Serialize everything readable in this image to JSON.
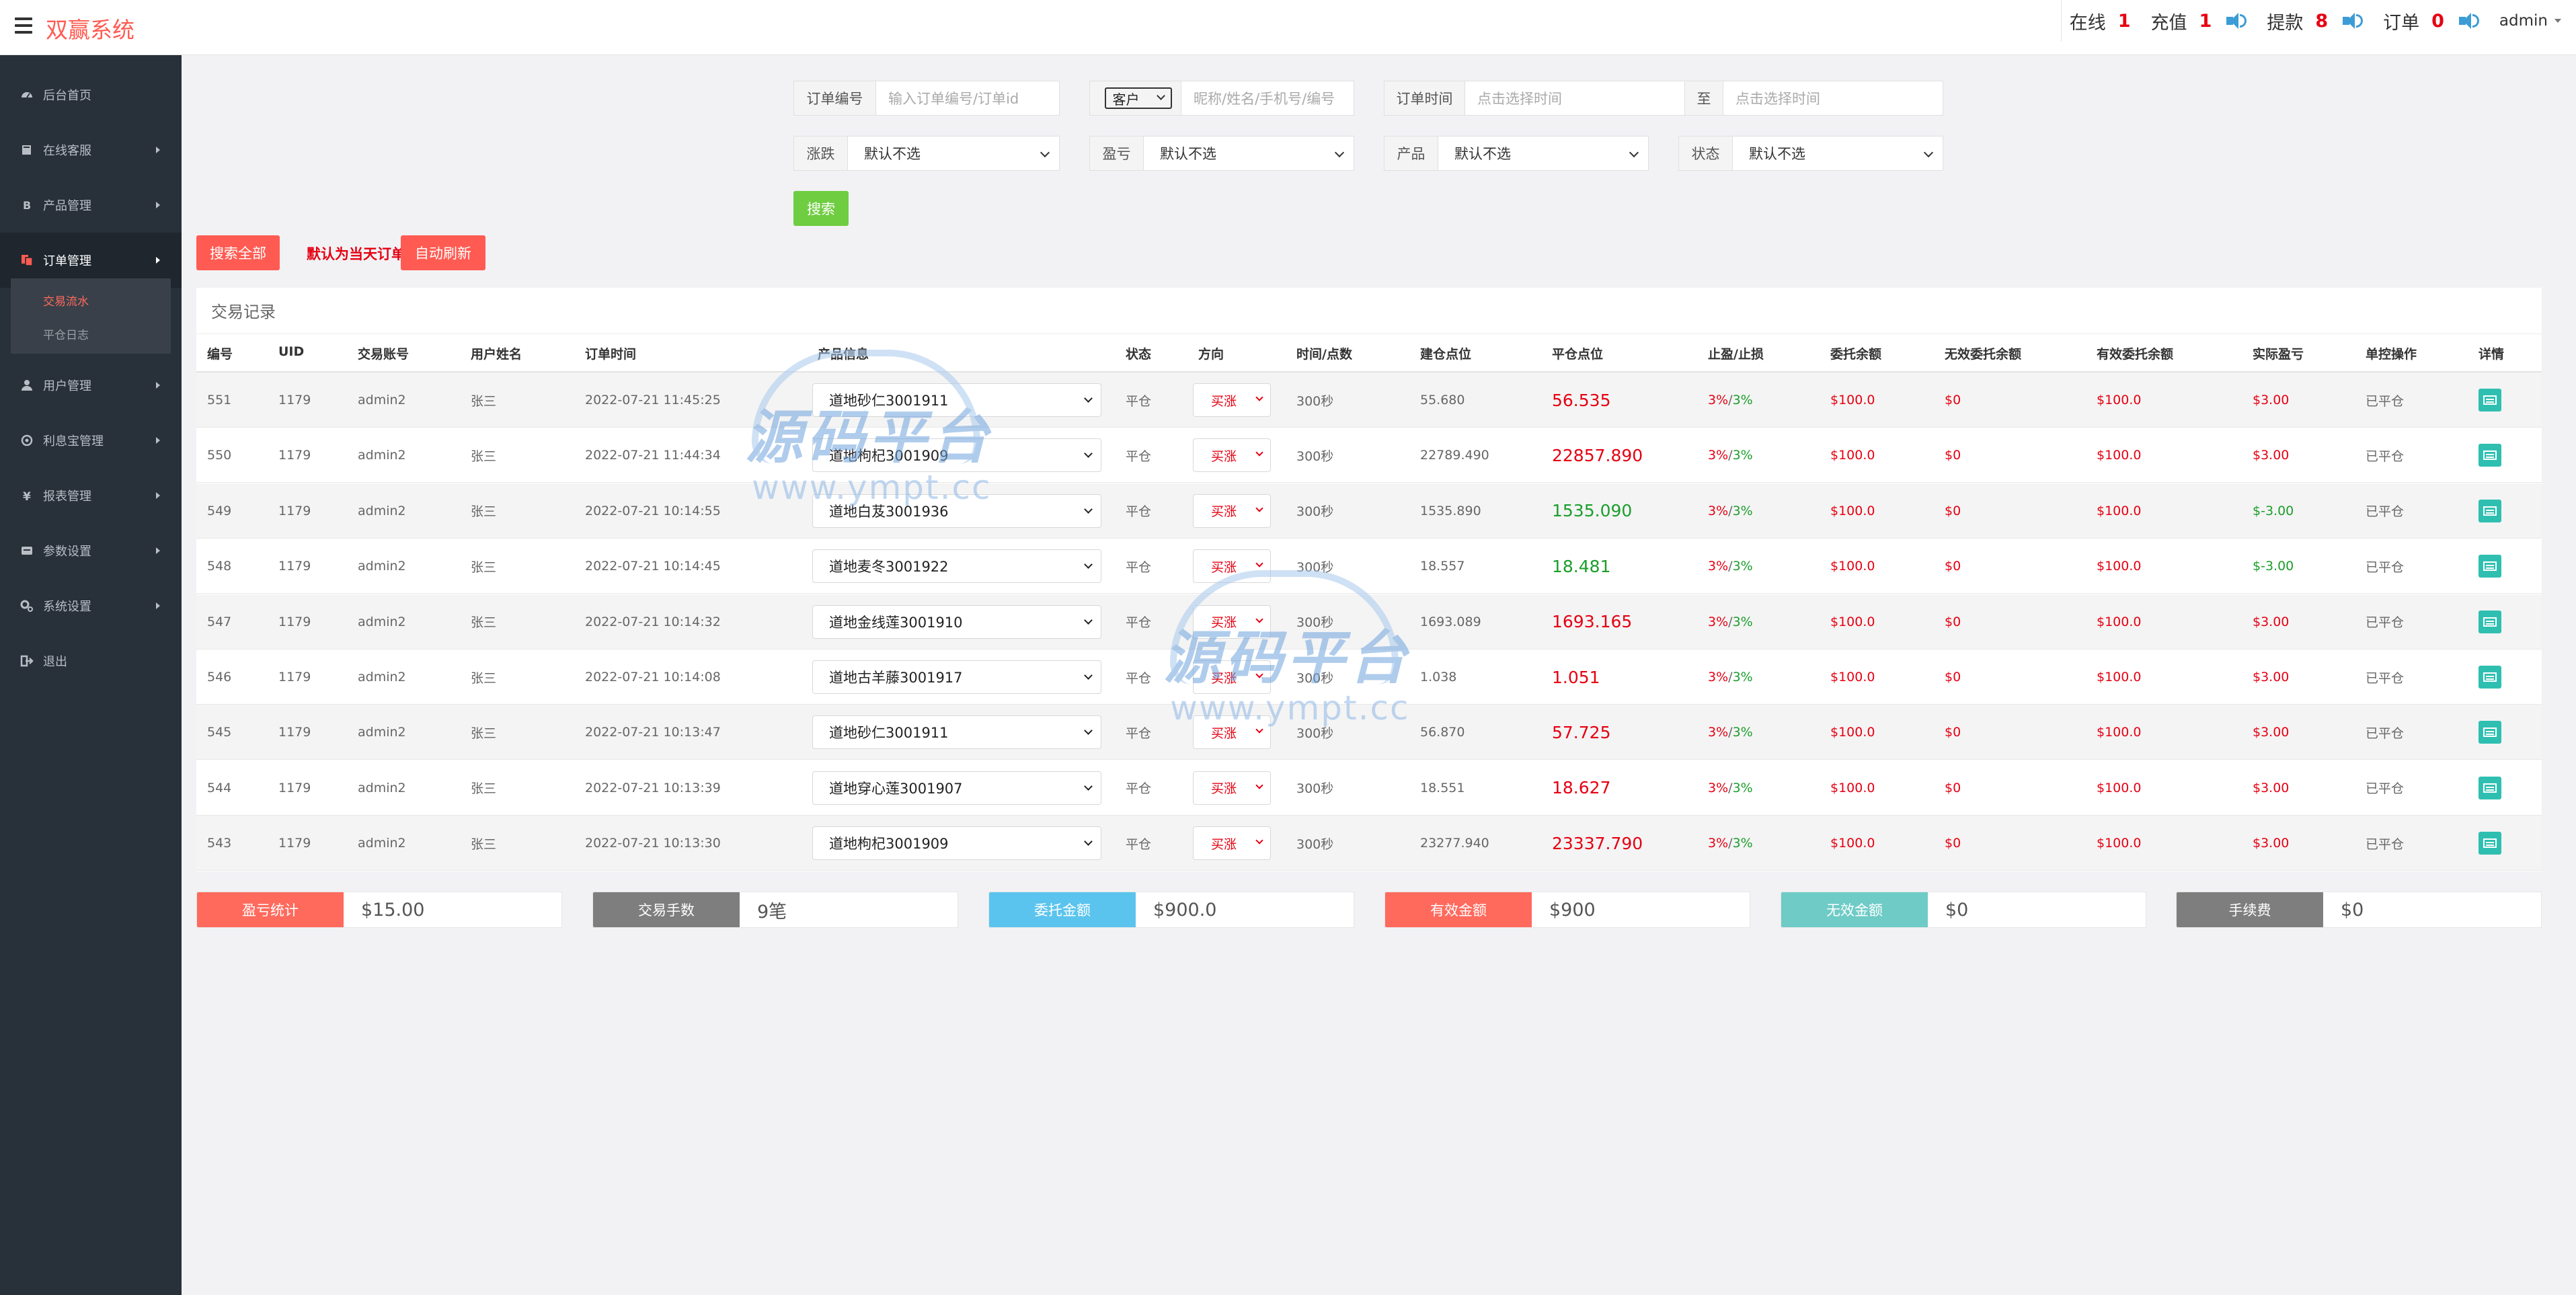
{
  "app": {
    "title": "双赢系统"
  },
  "header": {
    "stats": [
      {
        "label": "在线",
        "value": "1",
        "speaker": false
      },
      {
        "label": "充值",
        "value": "1",
        "speaker": true
      },
      {
        "label": "提款",
        "value": "8",
        "speaker": true
      },
      {
        "label": "订单",
        "value": "0",
        "speaker": true
      }
    ],
    "user": "admin"
  },
  "sidebar": {
    "items": [
      {
        "label": "后台首页",
        "icon": "dashboard-icon",
        "has_children": false
      },
      {
        "label": "在线客服",
        "icon": "book-icon",
        "has_children": true
      },
      {
        "label": "产品管理",
        "icon": "bitcoin-icon",
        "has_children": true
      },
      {
        "label": "订单管理",
        "icon": "copy-icon",
        "has_children": true,
        "active": true
      },
      {
        "label": "用户管理",
        "icon": "user-icon",
        "has_children": true
      },
      {
        "label": "利息宝管理",
        "icon": "coins-icon",
        "has_children": true
      },
      {
        "label": "报表管理",
        "icon": "yen-icon",
        "has_children": true
      },
      {
        "label": "参数设置",
        "icon": "sliders-icon",
        "has_children": true
      },
      {
        "label": "系统设置",
        "icon": "gears-icon",
        "has_children": true
      },
      {
        "label": "退出",
        "icon": "logout-icon",
        "has_children": false
      }
    ],
    "sub_items": [
      {
        "label": "交易流水",
        "active": true
      },
      {
        "label": "平仓日志",
        "active": false
      }
    ]
  },
  "filters": {
    "order_no": {
      "label": "订单编号",
      "placeholder": "输入订单编号/订单id"
    },
    "customer": {
      "select": "客户",
      "placeholder": "昵称/姓名/手机号/编号"
    },
    "order_time": {
      "label": "订单时间",
      "placeholder": "点击选择时间",
      "to": "至",
      "placeholder_end": "点击选择时间"
    },
    "rise_fall": {
      "label": "涨跌",
      "value": "默认不选"
    },
    "profit_loss": {
      "label": "盈亏",
      "value": "默认不选"
    },
    "product": {
      "label": "产品",
      "value": "默认不选"
    },
    "status": {
      "label": "状态",
      "value": "默认不选"
    },
    "search_button": "搜索",
    "search_all_button": "搜索全部",
    "default_note": "默认为当天订单",
    "auto_refresh_button": "自动刷新"
  },
  "table": {
    "title": "交易记录",
    "columns": [
      "编号",
      "UID",
      "交易账号",
      "用户姓名",
      "订单时间",
      "产品信息",
      "状态",
      "方向",
      "时间/点数",
      "建仓点位",
      "平仓点位",
      "止盈/止损",
      "委托余额",
      "无效委托余额",
      "有效委托余额",
      "实际盈亏",
      "单控操作",
      "详情"
    ],
    "rows": [
      {
        "id": "551",
        "uid": "1179",
        "account": "admin2",
        "name": "张三",
        "time": "2022-07-21 11:45:25",
        "product": "道地砂仁3001911",
        "status": "平仓",
        "direction": "买涨",
        "duration": "300秒",
        "open": "55.680",
        "close": "56.535",
        "close_color": "red",
        "tp": "3%",
        "sl": "3%",
        "amount": "$100.0",
        "invalid": "$0",
        "valid": "$100.0",
        "profit": "$3.00",
        "profit_color": "red",
        "op": "已平仓"
      },
      {
        "id": "550",
        "uid": "1179",
        "account": "admin2",
        "name": "张三",
        "time": "2022-07-21 11:44:34",
        "product": "道地枸杞3001909",
        "status": "平仓",
        "direction": "买涨",
        "duration": "300秒",
        "open": "22789.490",
        "close": "22857.890",
        "close_color": "red",
        "tp": "3%",
        "sl": "3%",
        "amount": "$100.0",
        "invalid": "$0",
        "valid": "$100.0",
        "profit": "$3.00",
        "profit_color": "red",
        "op": "已平仓"
      },
      {
        "id": "549",
        "uid": "1179",
        "account": "admin2",
        "name": "张三",
        "time": "2022-07-21 10:14:55",
        "product": "道地白芨3001936",
        "status": "平仓",
        "direction": "买涨",
        "duration": "300秒",
        "open": "1535.890",
        "close": "1535.090",
        "close_color": "green",
        "tp": "3%",
        "sl": "3%",
        "amount": "$100.0",
        "invalid": "$0",
        "valid": "$100.0",
        "profit": "$-3.00",
        "profit_color": "green",
        "op": "已平仓"
      },
      {
        "id": "548",
        "uid": "1179",
        "account": "admin2",
        "name": "张三",
        "time": "2022-07-21 10:14:45",
        "product": "道地麦冬3001922",
        "status": "平仓",
        "direction": "买涨",
        "duration": "300秒",
        "open": "18.557",
        "close": "18.481",
        "close_color": "green",
        "tp": "3%",
        "sl": "3%",
        "amount": "$100.0",
        "invalid": "$0",
        "valid": "$100.0",
        "profit": "$-3.00",
        "profit_color": "green",
        "op": "已平仓"
      },
      {
        "id": "547",
        "uid": "1179",
        "account": "admin2",
        "name": "张三",
        "time": "2022-07-21 10:14:32",
        "product": "道地金线莲3001910",
        "status": "平仓",
        "direction": "买涨",
        "duration": "300秒",
        "open": "1693.089",
        "close": "1693.165",
        "close_color": "red",
        "tp": "3%",
        "sl": "3%",
        "amount": "$100.0",
        "invalid": "$0",
        "valid": "$100.0",
        "profit": "$3.00",
        "profit_color": "red",
        "op": "已平仓"
      },
      {
        "id": "546",
        "uid": "1179",
        "account": "admin2",
        "name": "张三",
        "time": "2022-07-21 10:14:08",
        "product": "道地古羊藤3001917",
        "status": "平仓",
        "direction": "买涨",
        "duration": "300秒",
        "open": "1.038",
        "close": "1.051",
        "close_color": "red",
        "tp": "3%",
        "sl": "3%",
        "amount": "$100.0",
        "invalid": "$0",
        "valid": "$100.0",
        "profit": "$3.00",
        "profit_color": "red",
        "op": "已平仓"
      },
      {
        "id": "545",
        "uid": "1179",
        "account": "admin2",
        "name": "张三",
        "time": "2022-07-21 10:13:47",
        "product": "道地砂仁3001911",
        "status": "平仓",
        "direction": "买涨",
        "duration": "300秒",
        "open": "56.870",
        "close": "57.725",
        "close_color": "red",
        "tp": "3%",
        "sl": "3%",
        "amount": "$100.0",
        "invalid": "$0",
        "valid": "$100.0",
        "profit": "$3.00",
        "profit_color": "red",
        "op": "已平仓"
      },
      {
        "id": "544",
        "uid": "1179",
        "account": "admin2",
        "name": "张三",
        "time": "2022-07-21 10:13:39",
        "product": "道地穿心莲3001907",
        "status": "平仓",
        "direction": "买涨",
        "duration": "300秒",
        "open": "18.551",
        "close": "18.627",
        "close_color": "red",
        "tp": "3%",
        "sl": "3%",
        "amount": "$100.0",
        "invalid": "$0",
        "valid": "$100.0",
        "profit": "$3.00",
        "profit_color": "red",
        "op": "已平仓"
      },
      {
        "id": "543",
        "uid": "1179",
        "account": "admin2",
        "name": "张三",
        "time": "2022-07-21 10:13:30",
        "product": "道地枸杞3001909",
        "status": "平仓",
        "direction": "买涨",
        "duration": "300秒",
        "open": "23277.940",
        "close": "23337.790",
        "close_color": "red",
        "tp": "3%",
        "sl": "3%",
        "amount": "$100.0",
        "invalid": "$0",
        "valid": "$100.0",
        "profit": "$3.00",
        "profit_color": "red",
        "op": "已平仓"
      }
    ]
  },
  "summary": [
    {
      "label": "盈亏统计",
      "value": "$15.00",
      "color": "#ff6a5d"
    },
    {
      "label": "交易手数",
      "value": "9笔",
      "color": "#7e7e7e"
    },
    {
      "label": "委托金额",
      "value": "$900.0",
      "color": "#5bc4ee"
    },
    {
      "label": "有效金额",
      "value": "$900",
      "color": "#ff6a5d"
    },
    {
      "label": "无效金额",
      "value": "$0",
      "color": "#6ecbc6"
    },
    {
      "label": "手续费",
      "value": "$0",
      "color": "#7e7e7e"
    }
  ],
  "watermark": {
    "brand": "源码平台",
    "url": "www.ympt.cc"
  },
  "colors": {
    "accent": "#ff5b52",
    "sidebar": "#28303a",
    "profit_up": "#e60012",
    "profit_down": "#1b9e2b",
    "teal": "#2fbfb1"
  }
}
